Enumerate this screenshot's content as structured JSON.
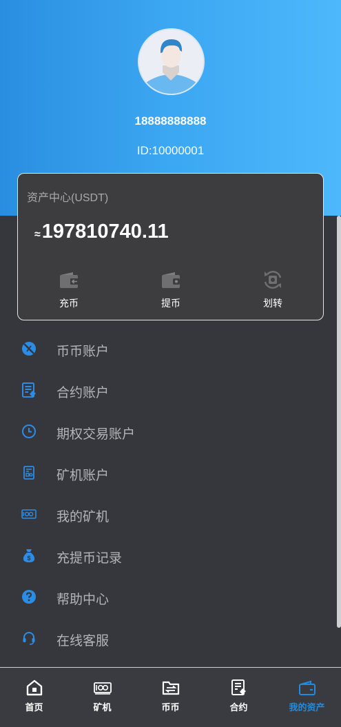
{
  "profile": {
    "phone": "18888888888",
    "uid": "ID:10000001"
  },
  "asset_card": {
    "title": "资产中心(USDT)",
    "approx_symbol": "≈",
    "amount": "197810740.11",
    "actions": [
      {
        "label": "充币",
        "icon": "wallet-deposit-icon"
      },
      {
        "label": "提币",
        "icon": "wallet-withdraw-icon"
      },
      {
        "label": "划转",
        "icon": "transfer-icon"
      }
    ]
  },
  "menu": {
    "items": [
      {
        "label": "币币账户",
        "icon": "coin-account-icon"
      },
      {
        "label": "合约账户",
        "icon": "contract-account-icon"
      },
      {
        "label": "期权交易账户",
        "icon": "clock-icon"
      },
      {
        "label": "矿机账户",
        "icon": "miner-account-icon"
      },
      {
        "label": "我的矿机",
        "icon": "miner-icon"
      },
      {
        "label": "充提币记录",
        "icon": "money-bag-icon"
      },
      {
        "label": "帮助中心",
        "icon": "help-icon"
      },
      {
        "label": "在线客服",
        "icon": "headset-icon"
      }
    ]
  },
  "tabbar": {
    "tabs": [
      {
        "label": "首页",
        "icon": "home-icon",
        "active": false
      },
      {
        "label": "矿机",
        "icon": "miner-icon",
        "active": false
      },
      {
        "label": "币币",
        "icon": "exchange-folder-icon",
        "active": false
      },
      {
        "label": "合约",
        "icon": "contract-icon",
        "active": false
      },
      {
        "label": "我的资产",
        "icon": "wallet-icon",
        "active": true
      }
    ]
  },
  "colors": {
    "accent": "#1e8ce0",
    "header_gradient_start": "#2a8ee0",
    "header_gradient_end": "#4db8fb",
    "background": "#36373d",
    "card": "#3d3d3f"
  }
}
